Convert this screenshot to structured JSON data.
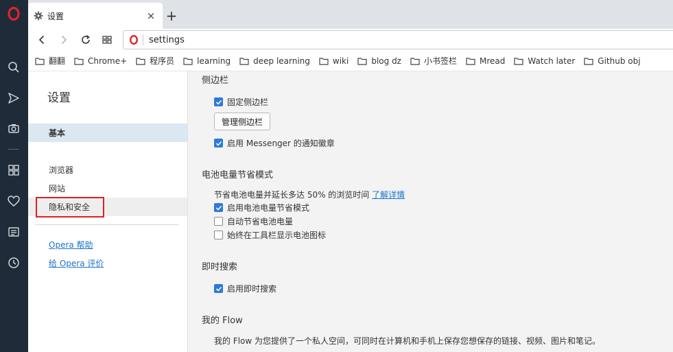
{
  "tab": {
    "title": "设置",
    "close": "×",
    "new_tab": "+"
  },
  "address": {
    "url": "settings"
  },
  "bookmarks": [
    "翻翻",
    "Chrome+",
    "程序员",
    "learning",
    "deep learning",
    "wiki",
    "blog dz",
    "小书签栏",
    "Mread",
    "Watch later",
    "Github obj"
  ],
  "nav": {
    "title": "设置",
    "items": [
      "基本",
      "浏览器",
      "网站",
      "隐私和安全"
    ],
    "links": [
      "Opera 帮助",
      "给 Opera 评价"
    ]
  },
  "sections": {
    "sidebar": {
      "title": "侧边栏",
      "pin_label": "固定侧边栏",
      "manage_button": "管理侧边栏",
      "messenger_label": "启用 Messenger 的通知徽章"
    },
    "battery": {
      "title": "电池电量节省模式",
      "desc": "节省电池电量并延长多达 50% 的浏览时间",
      "learn_more": "了解详情",
      "enable_label": "启用电池电量节省模式",
      "auto_label": "自动节省电池电量",
      "toolbar_label": "始终在工具栏显示电池图标"
    },
    "instant_search": {
      "title": "即时搜索",
      "enable_label": "启用即时搜索"
    },
    "flow": {
      "title": "我的 Flow",
      "desc": "我的 Flow 为您提供了一个私人空间，可同时在计算机和手机上保存您想保存的链接、视频、图片和笔记。"
    }
  },
  "colors": {
    "accent": "#2f7ad8",
    "rail": "#1f2b38",
    "opera_red": "#e0242b"
  }
}
